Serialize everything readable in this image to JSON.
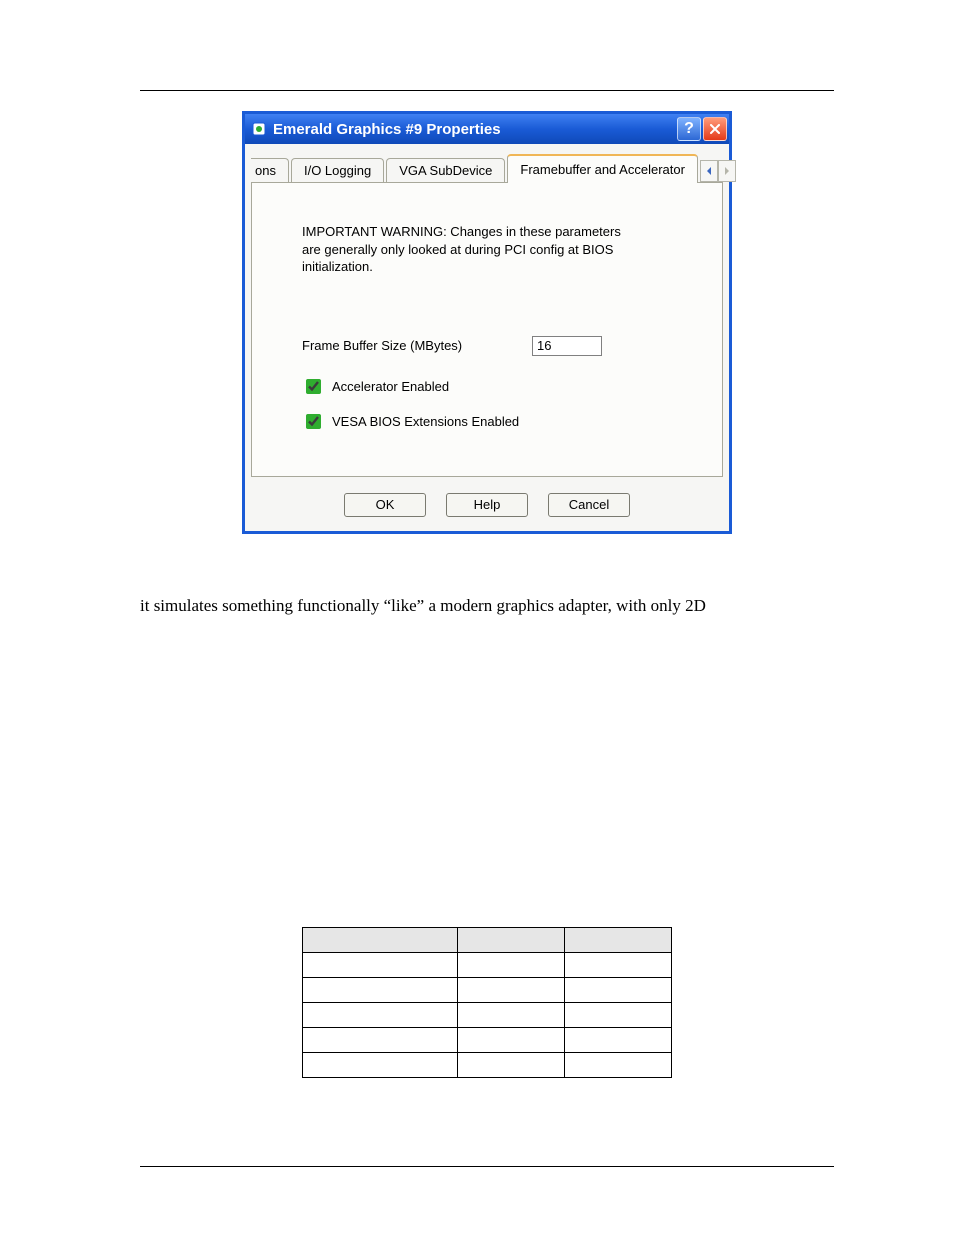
{
  "dialog": {
    "title": "Emerald Graphics #9 Properties",
    "tabs": {
      "partial": "ons",
      "io_logging": "I/O Logging",
      "vga_subdevice": "VGA SubDevice",
      "fb_accel": "Framebuffer and Accelerator"
    },
    "warning": "IMPORTANT WARNING:  Changes in these parameters are generally only looked at during PCI config at BIOS initialization.",
    "frame_buffer_label": "Frame Buffer Size (MBytes)",
    "frame_buffer_value": "16",
    "accel_enabled_label": "Accelerator Enabled",
    "vesa_enabled_label": "VESA BIOS Extensions Enabled",
    "buttons": {
      "ok": "OK",
      "help": "Help",
      "cancel": "Cancel"
    }
  },
  "paragraph": "it simulates something functionally “like” a modern graphics adapter, with only 2D",
  "table": {
    "headers": [
      "",
      "",
      ""
    ],
    "rows": [
      [
        "",
        "",
        ""
      ],
      [
        "",
        "",
        ""
      ],
      [
        "",
        "",
        ""
      ],
      [
        "",
        "",
        ""
      ],
      [
        "",
        "",
        ""
      ]
    ]
  }
}
